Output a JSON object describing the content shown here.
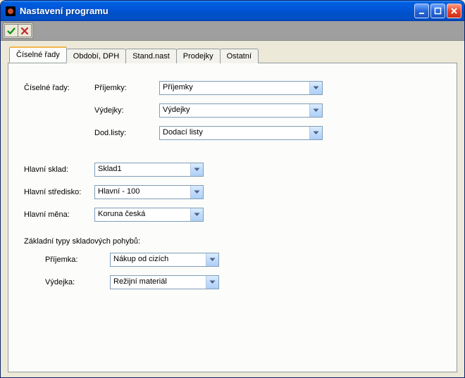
{
  "window": {
    "title": "Nastavení programu"
  },
  "tabs": [
    {
      "label": "Číselné řady",
      "active": true
    },
    {
      "label": "Období, DPH"
    },
    {
      "label": "Stand.nast"
    },
    {
      "label": "Prodejky"
    },
    {
      "label": "Ostatní"
    }
  ],
  "labels": {
    "ciselne_rady": "Číselné řady:",
    "prijemky": "Příjemky:",
    "vydejky": "Výdejky:",
    "dod_listy": "Dod.listy:",
    "hlavni_sklad": "Hlavní sklad:",
    "hlavni_stredisko": "Hlavní středisko:",
    "hlavni_mena": "Hlavní měna:",
    "zakladni_typy": "Základní typy skladových pohybů:",
    "prijemka": "Příjemka:",
    "vydejka": "Výdejka:"
  },
  "values": {
    "prijemky": "Příjemky",
    "vydejky": "Výdejky",
    "dod_listy": "Dodací listy",
    "hlavni_sklad": "Sklad1",
    "hlavni_stredisko": "Hlavní - 100",
    "hlavni_mena": "Koruna česká",
    "prijemka": "Nákup od cizích",
    "vydejka": "Režijní materiál"
  }
}
